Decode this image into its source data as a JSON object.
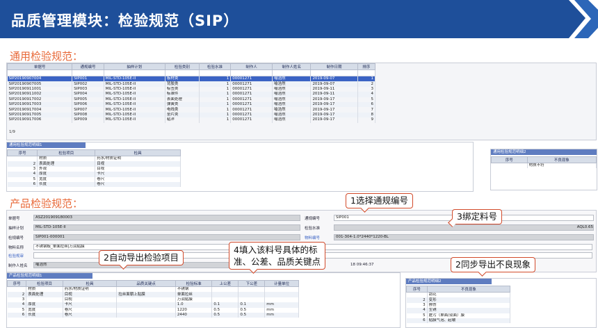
{
  "header": {
    "title": "品质管理模块：检验规范（SIP）",
    "color": "#1e4f9a",
    "accent": "#2c66b8"
  },
  "section1": {
    "title": "通用检验规范："
  },
  "section2": {
    "title": "产品检验规范："
  },
  "main_grid": {
    "columns": [
      "单据号",
      "通规编号",
      "抽样计划",
      "检验类别",
      "检验水准",
      "制作人",
      "制作人姓名",
      "制作日期",
      "排序"
    ],
    "rows": [
      [
        "SIP20190907004",
        "SIP001",
        "MIL-STD-105E-II",
        "板材类",
        "1",
        "00001271",
        "喻浩然",
        "2019-09-07",
        "1"
      ],
      [
        "SIP20190907005",
        "SIP002",
        "MIL-STD-105E-II",
        "背胶类",
        "1",
        "00001271",
        "喻浩然",
        "2019-09-07",
        "2"
      ],
      [
        "SIP20190911001",
        "SIP003",
        "MIL-STD-105E-II",
        "标签类",
        "1",
        "00001271",
        "喻浩然",
        "2019-09-11",
        "3"
      ],
      [
        "SIP20190911002",
        "SIP004",
        "MIL-STD-105E-II",
        "标准件",
        "1",
        "00001271",
        "喻浩然",
        "2019-09-11",
        "4"
      ],
      [
        "SIP20190917002",
        "SIP005",
        "MIL-STD-105E-II",
        "表面处理",
        "1",
        "00001271",
        "喻浩然",
        "2019-09-17",
        "5"
      ],
      [
        "SIP20190917003",
        "SIP006",
        "MIL-STD-105E-II",
        "弹簧类",
        "1",
        "00001271",
        "喻浩然",
        "2019-09-17",
        "6"
      ],
      [
        "SIP20190917004",
        "SIP007",
        "MIL-STD-105E-II",
        "电线类",
        "1",
        "00001271",
        "喻浩然",
        "2019-09-17",
        "7"
      ],
      [
        "SIP20190917005",
        "SIP008",
        "MIL-STD-105E-II",
        "垫片类",
        "1",
        "00001271",
        "喻浩然",
        "2019-09-17",
        "8"
      ],
      [
        "SIP20190917006",
        "SIP009",
        "MIL-STD-105E-II",
        "粘洋",
        "1",
        "00001271",
        "喻浩然",
        "2019-09-17",
        "9"
      ]
    ],
    "pager": "1/9"
  },
  "items_panel": {
    "title": "通用检验规范明细1",
    "columns": [
      "序号",
      "检验项目",
      "检具"
    ],
    "rows": [
      [
        "",
        "材质",
        "药水/材质证明"
      ],
      [
        "2",
        "表面处理",
        "目视"
      ],
      [
        "3",
        "外观",
        "目视"
      ],
      [
        "4",
        "厚度",
        "卡尺"
      ],
      [
        "5",
        "宽度",
        "卷尺"
      ],
      [
        "6",
        "长度",
        "卷尺"
      ]
    ]
  },
  "defect_panel": {
    "title": "通用检验规范明细2",
    "columns": [
      "序号",
      "不良现象"
    ],
    "rows": [
      [
        "",
        "材质不符"
      ]
    ]
  },
  "form": {
    "doc_no_label": "单据号",
    "doc_no": "ASZ201909180003",
    "sampling_label": "抽样计划",
    "sampling": "MIL-STD-105E-II",
    "spec_no_label": "检规编号",
    "spec_no": "SIP001-000001",
    "material_name_label": "物料名称",
    "material_name": "不锈钢板_单面拉丝|万润贴膜",
    "inspect_spec_label": "检验规审",
    "maker_label": "制作人姓名",
    "maker": "喻浩然",
    "general_no_label": "通规编号",
    "general_no": "SIP001",
    "level_label": "检验水准",
    "level_value": "AQL0.65",
    "material_no_label": "物料编号",
    "material_no": "001-304-1.0*2440*1220-BL",
    "time": "18 09:46:37"
  },
  "bottom_items": {
    "title": "产品检验规范明细1",
    "columns": [
      "序号",
      "检验项目",
      "检具",
      "品质关键点",
      "检验标准",
      "上公差",
      "下公差",
      "计量单位"
    ],
    "rows": [
      [
        "",
        "材质",
        "药水/材质证明",
        "",
        "不锈钢",
        "",
        "",
        ""
      ],
      [
        "2",
        "表面处理",
        "目视",
        "拉丝面朝上贴膜",
        "单面拉丝",
        "",
        "",
        ""
      ],
      [
        "3",
        "",
        "目视",
        "",
        "万润贴膜",
        "",
        "",
        ""
      ],
      [
        "4",
        "厚度",
        "卡尺",
        "",
        "1.0",
        "0.1",
        "0.1",
        "mm"
      ],
      [
        "5",
        "宽度",
        "卷尺",
        "",
        "1220",
        "0.5",
        "0.5",
        "mm"
      ],
      [
        "6",
        "长度",
        "卷尺",
        "",
        "2440",
        "0.5",
        "0.5",
        "mm"
      ]
    ]
  },
  "bottom_defects": {
    "title": "产品检验规范明细2",
    "columns": [
      "序号",
      "不良现象"
    ],
    "rows": [
      [
        "",
        "刮花"
      ],
      [
        "2",
        "变形"
      ],
      [
        "3",
        "擦伤"
      ],
      [
        "4",
        "生锈"
      ],
      [
        "5",
        "脏污（单面/双面）膜"
      ],
      [
        "6",
        "贴膜气泡、起皱"
      ]
    ]
  },
  "callouts": {
    "c1": "1选择通规编号",
    "c2": "2自动导出检验项目",
    "c3": "3绑定料号",
    "c4a": "4填入该料号具体的标",
    "c4b": "准、公差、品质关键点",
    "c5": "2同步导出不良现象"
  }
}
